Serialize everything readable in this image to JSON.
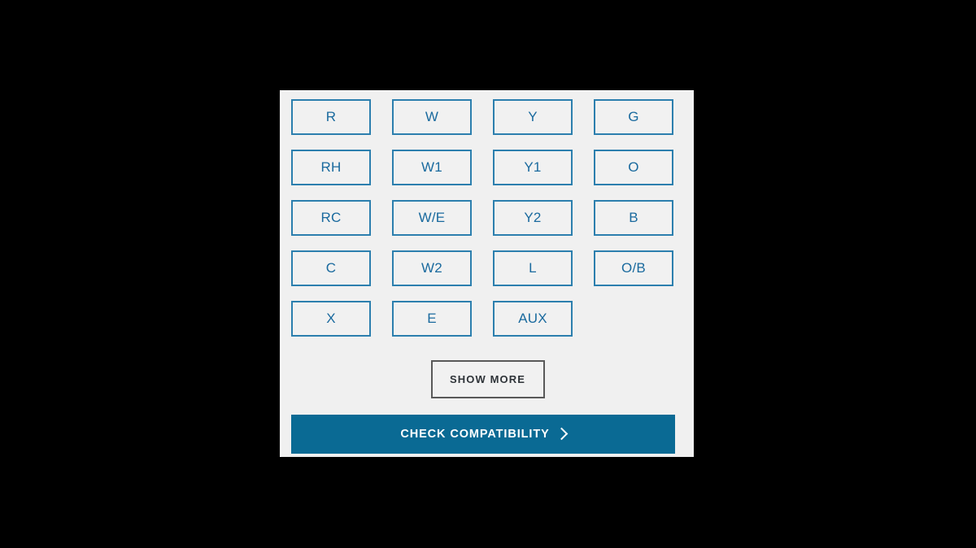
{
  "page": {
    "background_color": "#000000",
    "card_background": "#f0f0f0",
    "card_frame_color": "#ffffff"
  },
  "theme": {
    "terminal_border": "#2c7fae",
    "terminal_text": "#1a6a9e",
    "terminal_fill": "#f1f1f1",
    "cta_background": "#0a6a94",
    "cta_text": "#ffffff",
    "show_more_border": "#595959",
    "show_more_text": "#2e3338"
  },
  "terminal_selector": {
    "columns": 4,
    "terminals": [
      {
        "label": "R",
        "selected": false
      },
      {
        "label": "W",
        "selected": false
      },
      {
        "label": "Y",
        "selected": false
      },
      {
        "label": "G",
        "selected": false
      },
      {
        "label": "RH",
        "selected": false
      },
      {
        "label": "W1",
        "selected": false
      },
      {
        "label": "Y1",
        "selected": false
      },
      {
        "label": "O",
        "selected": false
      },
      {
        "label": "RC",
        "selected": false
      },
      {
        "label": "W/E",
        "selected": false
      },
      {
        "label": "Y2",
        "selected": false
      },
      {
        "label": "B",
        "selected": false
      },
      {
        "label": "C",
        "selected": false
      },
      {
        "label": "W2",
        "selected": false
      },
      {
        "label": "L",
        "selected": false
      },
      {
        "label": "O/B",
        "selected": false
      },
      {
        "label": "X",
        "selected": false
      },
      {
        "label": "E",
        "selected": false
      },
      {
        "label": "AUX",
        "selected": false
      }
    ]
  },
  "actions": {
    "show_more_label": "Show more",
    "cta_label": "Check compatibility",
    "cta_icon": "chevron-right-icon"
  }
}
